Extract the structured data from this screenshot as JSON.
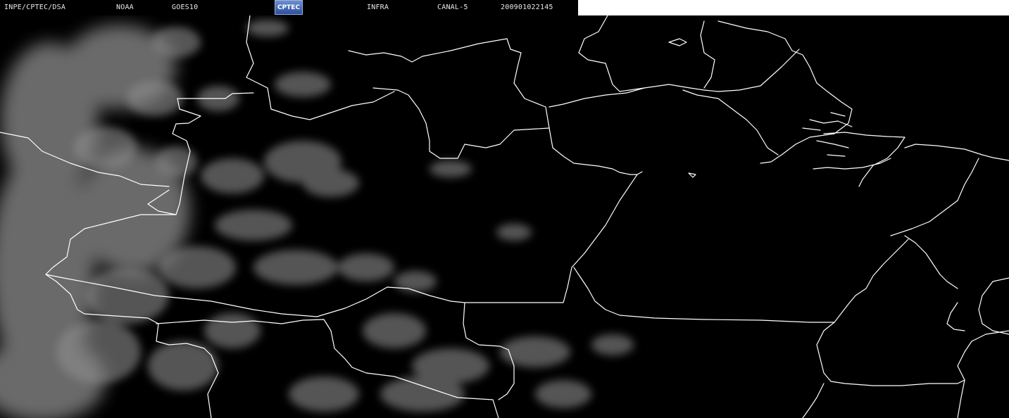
{
  "header": {
    "agency": "INPE/CPTEC/DSA",
    "operator": "NOAA",
    "satellite": "GOES10",
    "logo_text": "CPTEC",
    "product": "INFRA",
    "channel": "CANAL-5",
    "timestamp": "200901022145"
  },
  "colors": {
    "background": "#000000",
    "borders": "#ffffff",
    "clouds": "#9a9a9a",
    "logo": "#3a5fb0"
  }
}
